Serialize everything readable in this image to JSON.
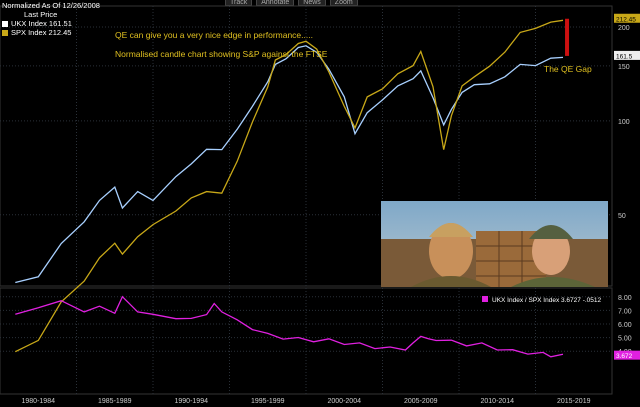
{
  "toolbar": {
    "items": [
      "Track",
      "Annotate",
      "News",
      "Zoom"
    ]
  },
  "legend": {
    "header": "Normalized As Of 12/26/2008",
    "last_price": "Last Price",
    "ukx": "UKX Index 161.51",
    "spx": "SPX Index 212.45",
    "ratio": "UKX Index / SPX Index 3.6727   -.0512"
  },
  "annotations": {
    "line1": "QE can give you a very nice edge in performance.....",
    "line2": "Normalised candle chart showing S&P against the FTSE",
    "gap": "The QE Gap"
  },
  "colors": {
    "ukx": "#a8d0ff",
    "spx": "#c8a818",
    "ratio": "#e020e0",
    "gap": "#cc1010",
    "grid": "#2a3038"
  },
  "chart_data": [
    {
      "type": "line",
      "series": [
        {
          "name": "UKX Index",
          "color": "#a8d0ff",
          "x": [
            1981.0,
            1982.5,
            1984.0,
            1985.5,
            1986.5,
            1987.5,
            1988.0,
            1989.0,
            1990.0,
            1991.5,
            1992.5,
            1993.5,
            1994.5,
            1995.5,
            1996.5,
            1997.5,
            1998.0,
            1998.7,
            1999.5,
            2000.0,
            2000.7,
            2001.5,
            2002.5,
            2003.2,
            2004.0,
            2005.0,
            2006.0,
            2007.0,
            2007.5,
            2008.3,
            2009.0,
            2009.5,
            2010.2,
            2011.0,
            2012.0,
            2013.0,
            2014.0,
            2015.0,
            2016.0,
            2016.8
          ],
          "y": [
            30,
            32,
            40,
            48,
            55,
            62,
            52,
            60,
            55,
            67,
            72,
            82,
            80,
            95,
            110,
            135,
            150,
            160,
            170,
            176,
            164,
            148,
            118,
            92,
            105,
            118,
            128,
            138,
            143,
            120,
            96,
            110,
            122,
            132,
            130,
            140,
            150,
            152,
            157,
            161.51
          ]
        },
        {
          "name": "SPX Index",
          "color": "#c8a818",
          "x": [
            1981.0,
            1982.5,
            1984.0,
            1985.5,
            1986.5,
            1987.5,
            1988.0,
            1989.0,
            1990.0,
            1991.5,
            1992.5,
            1993.5,
            1994.5,
            1995.5,
            1996.5,
            1997.5,
            1998.0,
            1998.7,
            1999.5,
            2000.0,
            2000.7,
            2001.5,
            2002.5,
            2003.2,
            2004.0,
            2005.0,
            2006.0,
            2007.0,
            2007.5,
            2008.3,
            2009.0,
            2009.5,
            2010.2,
            2011.0,
            2012.0,
            2013.0,
            2014.0,
            2015.0,
            2016.0,
            2016.8
          ],
          "y": [
            18,
            20,
            26,
            31,
            36,
            41,
            37,
            43,
            46,
            52,
            56,
            60,
            58,
            75,
            98,
            130,
            155,
            165,
            175,
            182,
            168,
            145,
            110,
            96,
            118,
            128,
            140,
            152,
            165,
            130,
            80,
            105,
            128,
            140,
            148,
            168,
            190,
            200,
            205,
            212.45
          ]
        }
      ],
      "ylim": [
        30,
        230
      ],
      "log_scale": true,
      "yticks": [
        50,
        100,
        150,
        200
      ],
      "grid": true,
      "last_labels": [
        "212.45",
        "161.5"
      ]
    },
    {
      "type": "line",
      "series": [
        {
          "name": "UKX Index / SPX Index",
          "color": "#e020e0",
          "x": [
            1981.0,
            1982.5,
            1984.0,
            1985.5,
            1986.5,
            1987.5,
            1988.0,
            1989.0,
            1990.0,
            1991.5,
            1992.5,
            1993.5,
            1994.0,
            1994.5,
            1995.5,
            1996.5,
            1997.5,
            1998.5,
            1999.5,
            2000.5,
            2001.5,
            2002.5,
            2003.5,
            2004.5,
            2005.5,
            2006.5,
            2007.0,
            2007.5,
            2008.0,
            2008.5,
            2009.5,
            2010.5,
            2011.5,
            2012.5,
            2013.5,
            2014.5,
            2015.5,
            2016.0,
            2016.8
          ],
          "y": [
            6.6,
            7.3,
            7.6,
            7.0,
            7.2,
            6.9,
            7.9,
            7.0,
            6.6,
            6.5,
            6.3,
            6.8,
            7.4,
            7.0,
            6.2,
            5.7,
            5.2,
            5.0,
            4.9,
            4.8,
            4.8,
            4.6,
            4.5,
            4.3,
            4.2,
            4.2,
            4.5,
            5.2,
            4.8,
            4.9,
            4.7,
            4.5,
            4.5,
            4.2,
            4.0,
            3.9,
            3.8,
            3.7,
            3.6727
          ]
        }
      ],
      "ylim": [
        3.5,
        8.5
      ],
      "yticks": [
        "8.00",
        "7.00",
        "6.00",
        "5.00",
        "4.00"
      ],
      "last_label": "3.672"
    }
  ],
  "x_axis": {
    "labels": [
      "1980-1984",
      "1985-1989",
      "1990-1994",
      "1995-1999",
      "2000-2004",
      "2005-2009",
      "2010-2014",
      "2015-2019"
    ]
  }
}
